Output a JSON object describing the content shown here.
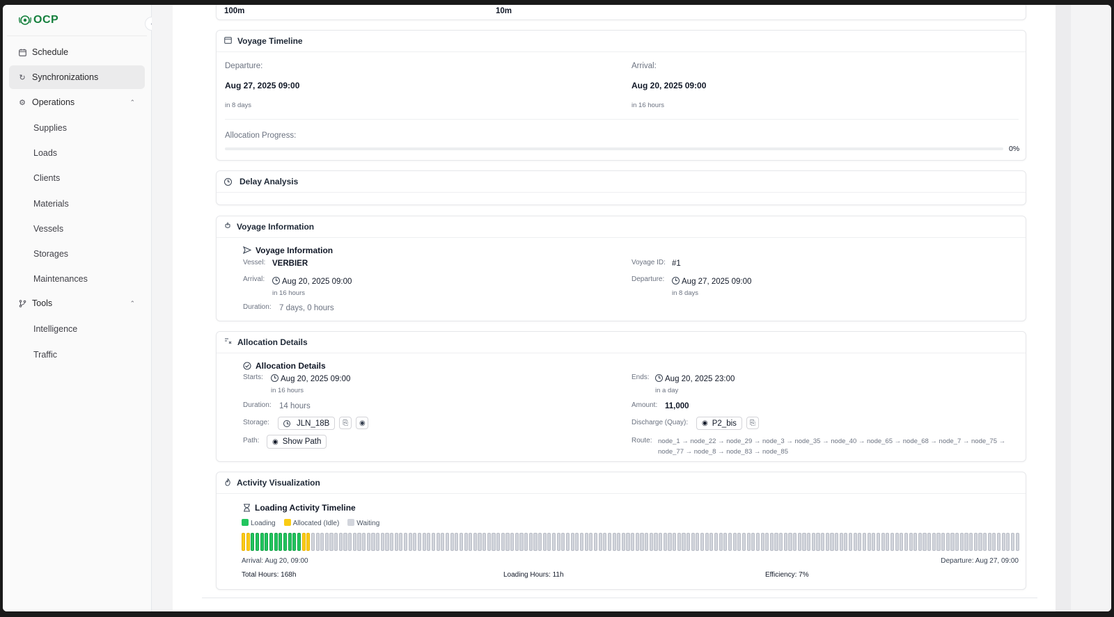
{
  "brand": {
    "name": "OCP"
  },
  "sidebar": {
    "collapse_icon": "chevron-left-icon",
    "items": [
      {
        "label": "Schedule",
        "icon": "calendar-icon"
      },
      {
        "label": "Synchronizations",
        "icon": "refresh-icon",
        "active": true
      },
      {
        "label": "Operations",
        "icon": "gear-icon"
      },
      {
        "label": "Tools",
        "icon": "branch-icon"
      }
    ],
    "operations_sub": [
      "Supplies",
      "Loads",
      "Clients",
      "Materials",
      "Vessels",
      "Storages",
      "Maintenances"
    ],
    "tools_sub": [
      "Intelligence",
      "Traffic"
    ]
  },
  "top_card": {
    "left_value": "100m",
    "right_value": "10m"
  },
  "voyage_timeline": {
    "title": "Voyage Timeline",
    "departure_label": "Departure:",
    "departure_value": "Aug 27, 2025 09:00",
    "departure_relative": "in 8 days",
    "arrival_label": "Arrival:",
    "arrival_value": "Aug 20, 2025 09:00",
    "arrival_relative": "in 16 hours",
    "progress_label": "Allocation Progress:",
    "progress_text": "0%",
    "progress_fraction": 0
  },
  "delay_analysis": {
    "title": "Delay Analysis"
  },
  "voyage_information": {
    "title": "Voyage Information",
    "subtitle": "Voyage Information",
    "vessel_label": "Vessel",
    "vessel_value": "VERBIER",
    "voyage_id_label": "Voyage ID",
    "voyage_id_value": "#1",
    "arrival_label": "Arrival",
    "arrival_value": "Aug 20, 2025 09:00",
    "arrival_relative": "in 16 hours",
    "departure_label": "Departure",
    "departure_value": "Aug 27, 2025 09:00",
    "departure_relative": "in 8 days",
    "duration_label": "Duration",
    "duration_value": "7 days, 0 hours"
  },
  "allocation_details": {
    "title": "Allocation Details",
    "subtitle": "Allocation Details",
    "starts_label": "Starts",
    "starts_value": "Aug 20, 2025 09:00",
    "starts_relative": "in 16 hours",
    "ends_label": "Ends",
    "ends_value": "Aug 20, 2025 23:00",
    "ends_relative": "in a day",
    "duration_label": "Duration",
    "duration_value": "14 hours",
    "amount_label": "Amount",
    "amount_value": "11,000",
    "storage_label": "Storage",
    "storage_value": "JLN_18B",
    "discharge_label": "Discharge (Quay)",
    "discharge_value": "P2_bis",
    "path_label": "Path",
    "show_path_label": "Show Path",
    "route_label": "Route",
    "route_line1": "node_1 → node_22 → node_29 → node_3 → node_35 → node_40 → node_65 → node_68 → node_7 → node_75 →",
    "route_line2": "node_77 → node_8 → node_83 → node_85"
  },
  "activity": {
    "title": "Activity Visualization",
    "subtitle": "Loading Activity Timeline",
    "legend": [
      {
        "label": "Loading",
        "color": "#22c55e"
      },
      {
        "label": "Allocated (Idle)",
        "color": "#facc15"
      },
      {
        "label": "Waiting",
        "color": "#d2d5dc"
      }
    ],
    "hours": {
      "allocated_before": 2,
      "loading": 11,
      "allocated_after": 2,
      "total": 168
    },
    "arrival_text": "Arrival: Aug 20, 09:00",
    "departure_text": "Departure: Aug 27, 09:00",
    "total_hours": "Total Hours: 168h",
    "loading_hours": "Loading Hours: 11h",
    "efficiency": "Efficiency: 7%"
  }
}
